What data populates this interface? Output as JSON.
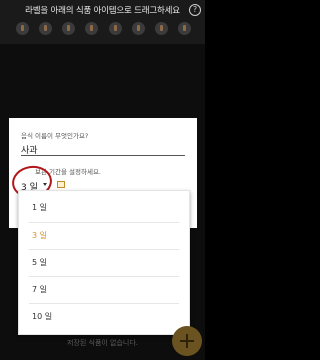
{
  "header": {
    "instruction": "라벨을 아래의 식품 아이템으로 드래그하세요",
    "help_symbol": "?",
    "food_icons": [
      "food-icon-1",
      "food-icon-2",
      "food-icon-3",
      "food-icon-4",
      "food-icon-5",
      "food-icon-6",
      "food-icon-7",
      "food-icon-8"
    ]
  },
  "form": {
    "question_name": "음식 이름이 무엇인가요?",
    "answer_name": "사과",
    "question_period": "보관 기간을 설정하세요.",
    "period_value": "3 일"
  },
  "dropdown": {
    "options": [
      "1 일",
      "3 일",
      "5 일",
      "7 일",
      "10 일"
    ],
    "selected_index": 1
  },
  "footer": {
    "empty_text": "저장된 식품이 없습니다.",
    "fab_symbol": "+"
  },
  "colors": {
    "accent": "#d9902a",
    "highlight_ring": "#b0171a",
    "fab": "#6a5320"
  }
}
